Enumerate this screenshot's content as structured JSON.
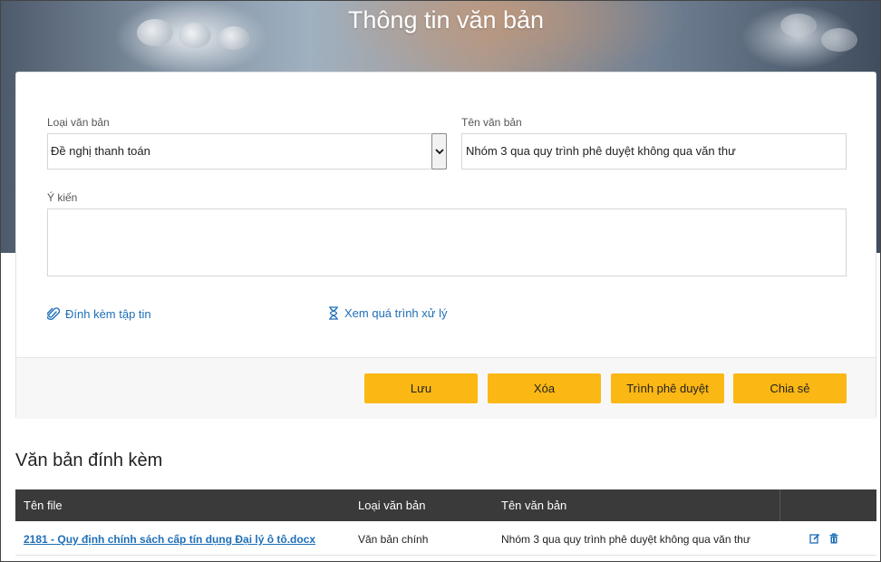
{
  "page": {
    "title": "Thông tin văn bản"
  },
  "form": {
    "doc_type": {
      "label": "Loại văn bản",
      "value": "Đề nghị thanh toán"
    },
    "doc_name": {
      "label": "Tên văn bản",
      "value": "Nhóm 3 qua quy trình phê duyệt không qua văn thư"
    },
    "comment": {
      "label": "Ý kiến",
      "value": ""
    },
    "attach_link": "Đính kèm tập tin",
    "history_link": "Xem quá trình xử lý"
  },
  "actions": {
    "save": "Lưu",
    "delete": "Xóa",
    "submit": "Trình phê duyệt",
    "share": "Chia sẻ"
  },
  "attachments": {
    "title": "Văn bản đính kèm",
    "columns": [
      "Tên file",
      "Loại văn bản",
      "Tên văn bản"
    ],
    "rows": [
      {
        "file": "2181 - Quy định chính sách cấp tín dụng Đại lý ô tô.docx",
        "type": "Văn bản chính",
        "name": "Nhóm 3 qua quy trình phê duyệt không qua văn thư"
      }
    ]
  },
  "colors": {
    "accent_button": "#fbb714",
    "link": "#1f6fb7",
    "table_header": "#3a3a3a"
  },
  "icons": [
    "paperclip-icon",
    "hourglass-icon",
    "chevron-down-icon",
    "edit-icon",
    "trash-icon"
  ]
}
